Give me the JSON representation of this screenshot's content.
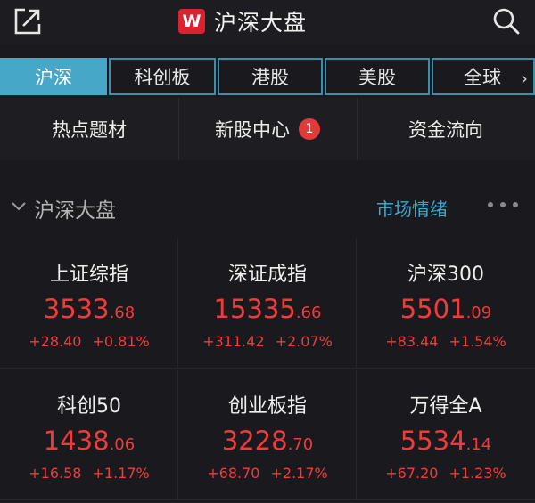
{
  "header": {
    "title": "沪深大盘",
    "logo_letter": "W",
    "back_icon": "open-external-icon",
    "search_icon": "search-icon"
  },
  "tabs": [
    {
      "label": "沪深",
      "active": true
    },
    {
      "label": "科创板",
      "active": false
    },
    {
      "label": "港股",
      "active": false
    },
    {
      "label": "美股",
      "active": false
    },
    {
      "label": "全球",
      "active": false
    }
  ],
  "tab_more_arrow": "›",
  "quick_links": [
    {
      "label": "热点题材"
    },
    {
      "label": "新股中心",
      "badge": "1"
    },
    {
      "label": "资金流向"
    }
  ],
  "section": {
    "title": "沪深大盘",
    "sentiment_link": "市场情绪"
  },
  "indices": [
    {
      "name": "上证综指",
      "int": "3533",
      "dec": ".68",
      "change": "+28.40",
      "percent": "+0.81%"
    },
    {
      "name": "深证成指",
      "int": "15335",
      "dec": ".66",
      "change": "+311.42",
      "percent": "+2.07%"
    },
    {
      "name": "沪深300",
      "int": "5501",
      "dec": ".09",
      "change": "+83.44",
      "percent": "+1.54%"
    },
    {
      "name": "科创50",
      "int": "1438",
      "dec": ".06",
      "change": "+16.58",
      "percent": "+1.17%"
    },
    {
      "name": "创业板指",
      "int": "3228",
      "dec": ".70",
      "change": "+68.70",
      "percent": "+2.17%"
    },
    {
      "name": "万得全A",
      "int": "5534",
      "dec": ".14",
      "change": "+67.20",
      "percent": "+1.23%"
    }
  ],
  "colors": {
    "up": "#ef3b3b",
    "accent": "#47a7c8",
    "link": "#3fa7cc",
    "badge": "#e03a3a",
    "brand": "#d9232d"
  }
}
